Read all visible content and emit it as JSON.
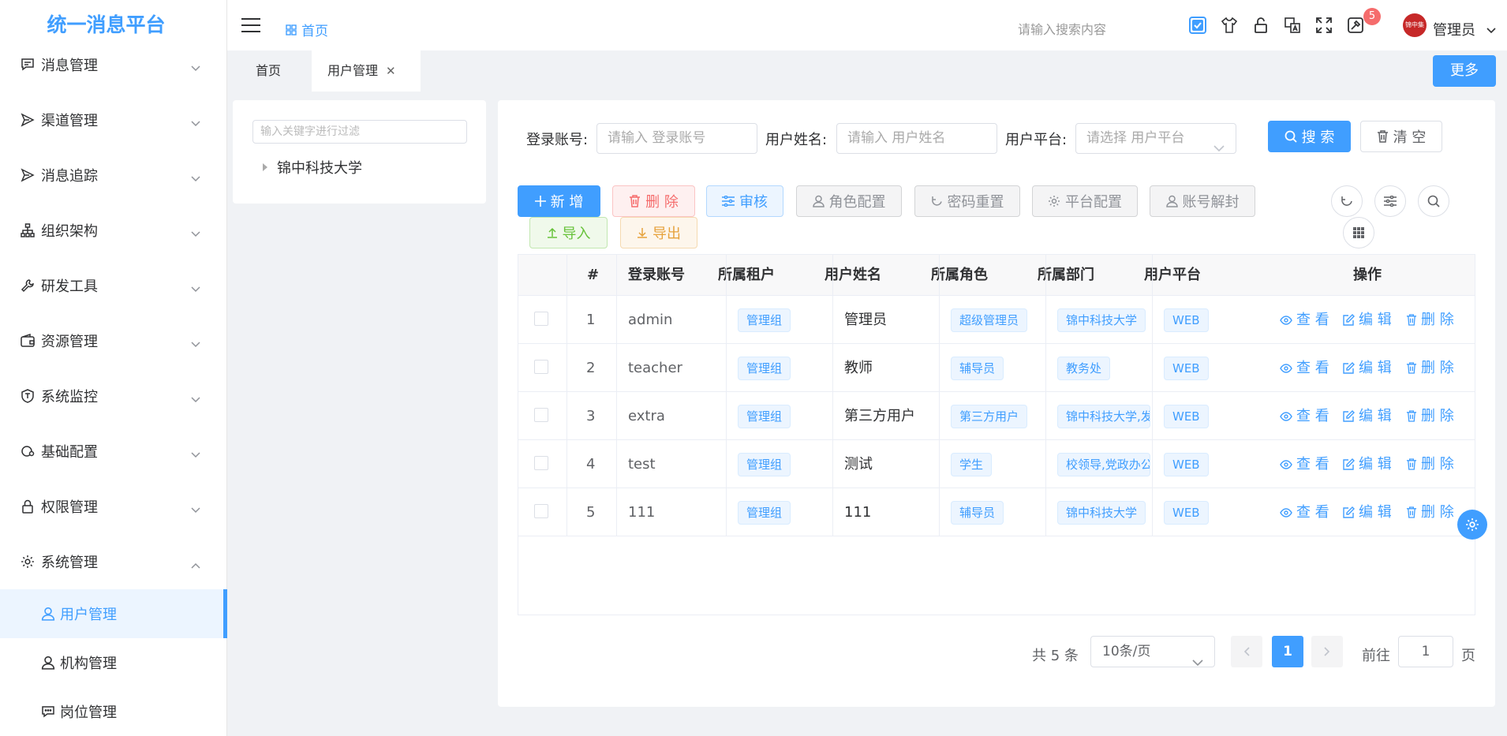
{
  "app": {
    "title": "统一消息平台"
  },
  "sidebar": {
    "menus": [
      {
        "label": "消息管理",
        "icon": "message-icon"
      },
      {
        "label": "渠道管理",
        "icon": "send-icon"
      },
      {
        "label": "消息追踪",
        "icon": "send-icon"
      },
      {
        "label": "组织架构",
        "icon": "org-chart-icon"
      },
      {
        "label": "研发工具",
        "icon": "wrench-icon"
      },
      {
        "label": "资源管理",
        "icon": "wallet-icon"
      },
      {
        "label": "系统监控",
        "icon": "shield-icon"
      },
      {
        "label": "基础配置",
        "icon": "config-icon"
      },
      {
        "label": "权限管理",
        "icon": "lock-icon"
      },
      {
        "label": "系统管理",
        "icon": "gear-icon"
      }
    ],
    "submenu": [
      {
        "label": "用户管理",
        "icon": "user-icon",
        "active": true
      },
      {
        "label": "机构管理",
        "icon": "user-icon"
      },
      {
        "label": "岗位管理",
        "icon": "chat-icon"
      }
    ]
  },
  "topbar": {
    "breadcrumb": "首页",
    "search_placeholder": "请输入搜索内容",
    "notification_count": "5",
    "avatar_text": "锦中集团",
    "user_name": "管理员"
  },
  "tabs": {
    "items": [
      {
        "label": "首页"
      },
      {
        "label": "用户管理",
        "active": true
      }
    ],
    "more_label": "更多"
  },
  "tree": {
    "filter_placeholder": "输入关键字进行过滤",
    "root_label": "锦中科技大学"
  },
  "filters": {
    "account_label": "登录账号:",
    "account_placeholder": "请输入 登录账号",
    "name_label": "用户姓名:",
    "name_placeholder": "请输入 用户姓名",
    "platform_label": "用户平台:",
    "platform_placeholder": "请选择 用户平台",
    "search_label": "搜 索",
    "clear_label": "清 空"
  },
  "toolbar": {
    "add": "新 增",
    "delete": "删 除",
    "audit": "审核",
    "role_config": "角色配置",
    "password_reset": "密码重置",
    "platform_config": "平台配置",
    "account_unlock": "账号解封",
    "import": "导入",
    "export": "导出"
  },
  "table": {
    "headers": {
      "index": "#",
      "account": "登录账号",
      "tenant": "所属租户",
      "name": "用户姓名",
      "role": "所属角色",
      "dept": "所属部门",
      "platform": "用户平台",
      "ops": "操作"
    },
    "rows": [
      {
        "index": "1",
        "account": "admin",
        "tenant": "管理组",
        "name": "管理员",
        "role": "超级管理员",
        "dept": "锦中科技大学",
        "platform": "WEB"
      },
      {
        "index": "2",
        "account": "teacher",
        "tenant": "管理组",
        "name": "教师",
        "role": "辅导员",
        "dept": "教务处",
        "platform": "WEB"
      },
      {
        "index": "3",
        "account": "extra",
        "tenant": "管理组",
        "name": "第三方用户",
        "role": "第三方用户",
        "dept": "锦中科技大学,发",
        "platform": "WEB"
      },
      {
        "index": "4",
        "account": "test",
        "tenant": "管理组",
        "name": "测试",
        "role": "学生",
        "dept": "校领导,党政办公",
        "platform": "WEB"
      },
      {
        "index": "5",
        "account": "111",
        "tenant": "管理组",
        "name": "111",
        "role": "辅导员",
        "dept": "锦中科技大学",
        "platform": "WEB"
      }
    ],
    "actions": {
      "view": "查 看",
      "edit": "编 辑",
      "delete": "删 除"
    }
  },
  "pagination": {
    "total": "共 5 条",
    "page_size": "10条/页",
    "current_page": "1",
    "goto_label": "前往",
    "goto_value": "1",
    "page_suffix": "页"
  },
  "colors": {
    "primary": "#409eff",
    "danger": "#f56c6c",
    "success": "#67c23a",
    "warning": "#e6a23c"
  }
}
